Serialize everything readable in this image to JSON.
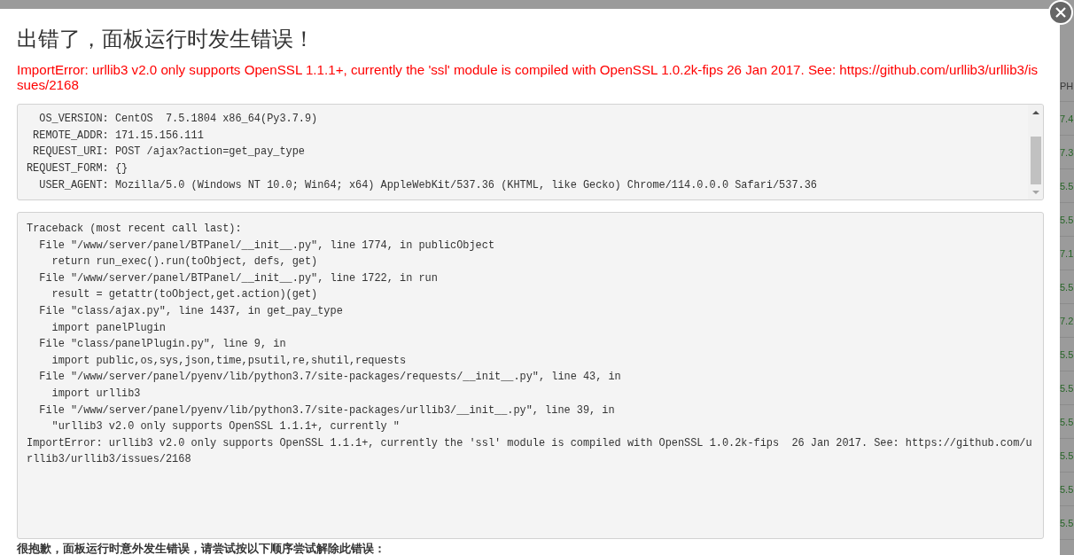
{
  "dialog": {
    "title": "出错了，面板运行时发生错误！",
    "error_message": "ImportError: urllib3 v2.0 only supports OpenSSL 1.1.1+, currently the 'ssl' module is compiled with OpenSSL 1.0.2k-fips 26 Jan 2017. See: https://github.com/urllib3/urllib3/issues/2168",
    "environment": [
      {
        "key": "OS_VERSION:",
        "value": "CentOS  7.5.1804 x86_64(Py3.7.9)"
      },
      {
        "key": "REMOTE_ADDR:",
        "value": "171.15.156.111"
      },
      {
        "key": "REQUEST_URI:",
        "value": "POST /ajax?action=get_pay_type"
      },
      {
        "key": "REQUEST_FORM:",
        "value": "{}"
      },
      {
        "key": "USER_AGENT:",
        "value": "Mozilla/5.0 (Windows NT 10.0; Win64; x64) AppleWebKit/537.36 (KHTML, like Gecko) Chrome/114.0.0.0 Safari/537.36"
      }
    ],
    "traceback": [
      {
        "text": "Traceback (most recent call last):",
        "children": [
          {
            "text": "File \"/www/server/panel/BTPanel/__init__.py\", line 1774, in publicObject",
            "children": [
              {
                "text": "return run_exec().run(toObject, defs, get)"
              }
            ]
          },
          {
            "text": "File \"/www/server/panel/BTPanel/__init__.py\", line 1722, in run",
            "children": [
              {
                "text": "result = getattr(toObject,get.action)(get)"
              }
            ]
          },
          {
            "text": "File \"class/ajax.py\", line 1437, in get_pay_type",
            "children": [
              {
                "text": "import panelPlugin"
              }
            ]
          },
          {
            "text": "File \"class/panelPlugin.py\", line 9, in",
            "children": [
              {
                "text": "import public,os,sys,json,time,psutil,re,shutil,requests"
              }
            ]
          },
          {
            "text": "File \"/www/server/panel/pyenv/lib/python3.7/site-packages/requests/__init__.py\", line 43, in",
            "children": [
              {
                "text": "import urllib3"
              }
            ]
          },
          {
            "text": "File \"/www/server/panel/pyenv/lib/python3.7/site-packages/urllib3/__init__.py\", line 39, in",
            "children": [
              {
                "text": "\"urllib3 v2.0 only supports OpenSSL 1.1.1+, currently \""
              }
            ]
          }
        ]
      },
      {
        "text": "ImportError: urllib3 v2.0 only supports OpenSSL 1.1.1+, currently the 'ssl' module is compiled with OpenSSL 1.0.2k-fips  26 Jan 2017. See: https://github.com/urllib3/urllib3/issues/2168"
      }
    ],
    "help_note": "很抱歉，面板运行时意外发生错误，请尝试按以下顺序尝试解除此错误："
  },
  "background_table": {
    "column_header": "PH",
    "cells": [
      "7.4",
      "7.3",
      "5.5",
      "5.5",
      "7.1",
      "5.5",
      "7.2",
      "5.5",
      "5.5",
      "5.5",
      "5.5",
      "5.5",
      "5.5"
    ]
  }
}
